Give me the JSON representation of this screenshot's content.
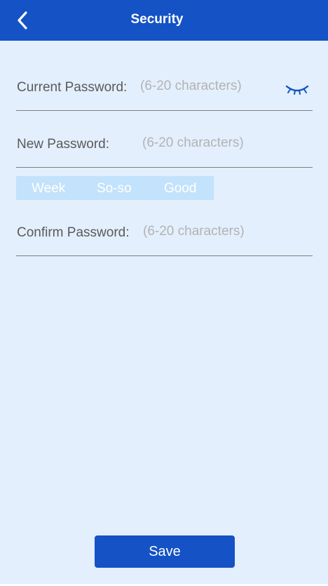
{
  "header": {
    "title": "Security",
    "back_icon": "chevron-left-icon",
    "background": "#1452c5"
  },
  "form": {
    "current_password": {
      "label": "Current Password:",
      "placeholder": "(6-20 characters)",
      "toggle_icon": "eye-closed-icon"
    },
    "new_password": {
      "label": "New Password:",
      "placeholder": "(6-20 characters)"
    },
    "strength": {
      "levels": [
        "Week",
        "So-so",
        "Good"
      ],
      "background": "#c3e2fb"
    },
    "confirm_password": {
      "label": "Confirm Password:",
      "placeholder": "(6-20 characters)"
    }
  },
  "save_button": {
    "label": "Save"
  },
  "colors": {
    "page_background": "#e3effd",
    "accent": "#1452c5",
    "placeholder": "#b3b3b3",
    "label": "#5a5a5a"
  }
}
